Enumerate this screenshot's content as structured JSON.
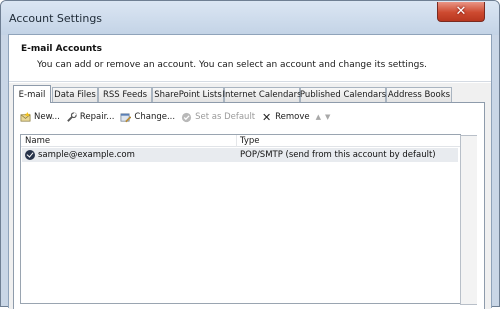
{
  "window": {
    "title": "Account Settings",
    "close_glyph": "✕"
  },
  "header": {
    "title": "E-mail Accounts",
    "subtitle": "You can add or remove an account. You can select an account and change its settings."
  },
  "tabs": [
    {
      "label": "E-mail",
      "active": true
    },
    {
      "label": "Data Files"
    },
    {
      "label": "RSS Feeds"
    },
    {
      "label": "SharePoint Lists"
    },
    {
      "label": "Internet Calendars"
    },
    {
      "label": "Published Calendars"
    },
    {
      "label": "Address Books"
    }
  ],
  "toolbar": {
    "new_label": "New...",
    "repair_label": "Repair...",
    "change_label": "Change...",
    "set_default_label": "Set as Default",
    "remove_label": "Remove",
    "remove_glyph": "✕",
    "up_glyph": "▲",
    "down_glyph": "▼"
  },
  "list": {
    "columns": [
      "Name",
      "Type"
    ],
    "rows": [
      {
        "name": "sample@example.com",
        "type": "POP/SMTP (send from this account by default)",
        "default": true
      }
    ]
  },
  "icons": {
    "new": "new-account-icon",
    "repair": "repair-icon",
    "change": "change-icon",
    "set_default": "set-default-icon",
    "remove": "remove-icon",
    "up": "move-up-icon",
    "down": "move-down-icon",
    "default_account": "default-account-check-icon"
  },
  "colors": {
    "close_button": "#cd4a30",
    "selected_row": "#e8ebef",
    "window_frame": "#c9d6e6"
  }
}
